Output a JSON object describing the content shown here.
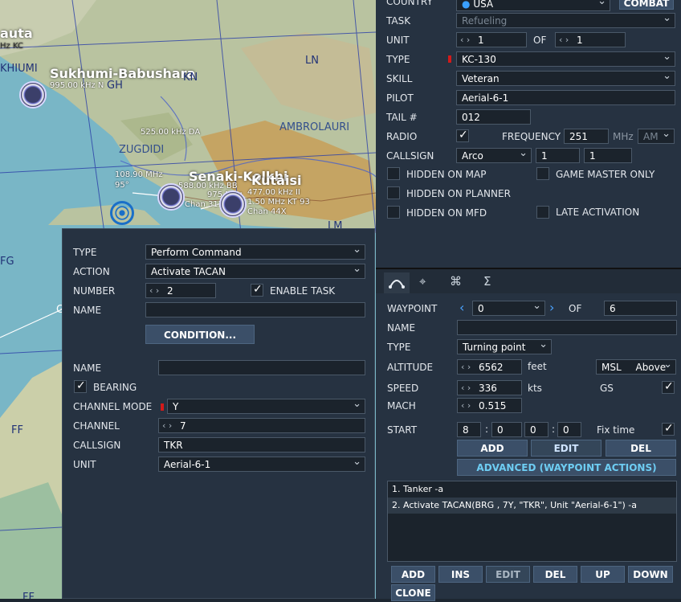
{
  "map": {
    "labels": {
      "sukhumi": "Sukhumi-Babushara",
      "senaki": "Senaki-Kolkhi",
      "kutaisi": "Kutaisi",
      "gauta": "auta",
      "zugdidi": "ZUGDIDI",
      "ambrolauri": "AMBROLAURI"
    },
    "grid": {
      "ln": "LN",
      "kn": "KN",
      "gh": "GH",
      "fg": "FG",
      "ff1": "FF",
      "ff2": "FF",
      "hiumi": "KHIUMI",
      "hz": "Hz KC",
      "g": "G",
      "lm": "LM"
    },
    "info": {
      "sukhumi_freq": "995.00 kHz N",
      "zugdidi_freq": "525.00 kHz DA",
      "tacan_freq": "108.90 MHz",
      "tacan_brg": "95°",
      "senaki_1": "588.00 kHz BB",
      "senaki_2": "975 MHz",
      "senaki_3": "Chan 31X",
      "kutaisi_1": "477.00 kHz II",
      "kutaisi_2": "1.50 MHz KT 93",
      "kutaisi_3": "Chan 44X"
    }
  },
  "unit": {
    "country_label": "COUNTRY",
    "country_value": "USA",
    "combat_btn": "COMBAT",
    "task_label": "TASK",
    "task_value": "Refueling",
    "unit_label": "UNIT",
    "unit_value": "1",
    "of_label": "OF",
    "unit_of_value": "1",
    "type_label": "TYPE",
    "type_value": "KC-130",
    "skill_label": "SKILL",
    "skill_value": "Veteran",
    "pilot_label": "PILOT",
    "pilot_value": "Aerial-6-1",
    "tail_label": "TAIL #",
    "tail_value": "012",
    "radio_label": "RADIO",
    "freq_label": "FREQUENCY",
    "freq_value": "251",
    "mhz_label": "MHz",
    "am_value": "AM",
    "callsign_label": "CALLSIGN",
    "callsign_value": "Arco",
    "callsign_n1": "1",
    "callsign_n2": "1",
    "hidden_map": "HIDDEN ON MAP",
    "gm_only": "GAME MASTER ONLY",
    "hidden_planner": "HIDDEN ON PLANNER",
    "hidden_mfd": "HIDDEN ON MFD",
    "late_activation": "LATE ACTIVATION"
  },
  "waypoint": {
    "tabs": [
      "route-icon",
      "target-icon",
      "gear-icon",
      "sigma-icon"
    ],
    "wp_label": "WAYPOINT",
    "wp_value": "0",
    "of_label": "OF",
    "of_value": "6",
    "name_label": "NAME",
    "name_value": "",
    "type_label": "TYPE",
    "type_value": "Turning point",
    "alt_label": "ALTITUDE",
    "alt_value": "6562",
    "alt_unit": "feet",
    "msl_value": "MSL",
    "above_value": "Above",
    "speed_label": "SPEED",
    "speed_value": "336",
    "speed_unit": "kts",
    "gs_label": "GS",
    "mach_label": "MACH",
    "mach_value": "0.515",
    "start_label": "START",
    "start_d": "8",
    "start_h": "0",
    "start_m": "0",
    "start_s": "0",
    "fix_time_label": "Fix time",
    "add_btn": "ADD",
    "edit_btn": "EDIT",
    "del_btn": "DEL",
    "advanced_btn": "ADVANCED (WAYPOINT ACTIONS)",
    "actions": [
      "1. Tanker -a",
      "2. Activate TACAN(BRG , 7Y, \"TKR\", Unit \"Aerial-6-1\")   -a"
    ],
    "bottom_btns": {
      "add": "ADD",
      "ins": "INS",
      "edit": "EDIT",
      "del": "DEL",
      "up": "UP",
      "down": "DOWN",
      "clone": "CLONE"
    }
  },
  "action": {
    "type_label": "TYPE",
    "type_value": "Perform Command",
    "action_label": "ACTION",
    "action_value": "Activate TACAN",
    "number_label": "NUMBER",
    "number_value": "2",
    "enable_task": "ENABLE TASK",
    "name_label": "NAME",
    "name_value": "",
    "condition_btn": "CONDITION...",
    "name2_label": "NAME",
    "name2_value": "",
    "bearing_label": "BEARING",
    "channel_mode_label": "CHANNEL MODE",
    "channel_mode_value": "Y",
    "channel_label": "CHANNEL",
    "channel_value": "7",
    "callsign_label": "CALLSIGN",
    "callsign_value": "TKR",
    "unit_label": "UNIT",
    "unit_value": "Aerial-6-1"
  }
}
